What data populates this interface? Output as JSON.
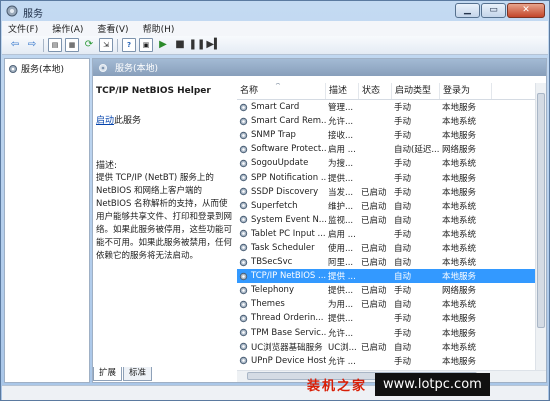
{
  "window": {
    "title": "服务"
  },
  "menu": [
    "文件(F)",
    "操作(A)",
    "查看(V)",
    "帮助(H)"
  ],
  "left_tree": {
    "item": "服务(本地)"
  },
  "right_header": {
    "title": "服务(本地)"
  },
  "description": {
    "service_name": "TCP/IP NetBIOS Helper",
    "start_link": "启动",
    "start_suffix": "此服务",
    "label": "描述:",
    "text": "提供 TCP/IP (NetBT) 服务上的 NetBIOS 和网络上客户端的 NetBIOS 名称解析的支持，从而使用户能够共享文件、打印和登录到网络。如果此服务被停用，这些功能可能不可用。如果此服务被禁用，任何依赖它的服务将无法启动。"
  },
  "table": {
    "headers": [
      "名称",
      "描述",
      "状态",
      "启动类型",
      "登录为"
    ],
    "rows": [
      {
        "name": "Smart Card",
        "desc": "管理...",
        "status": "",
        "startup": "手动",
        "logon": "本地服务"
      },
      {
        "name": "Smart Card Rem...",
        "desc": "允许...",
        "status": "",
        "startup": "手动",
        "logon": "本地系统"
      },
      {
        "name": "SNMP Trap",
        "desc": "接收...",
        "status": "",
        "startup": "手动",
        "logon": "本地服务"
      },
      {
        "name": "Software Protect...",
        "desc": "启用 ...",
        "status": "",
        "startup": "自动(延迟...",
        "logon": "网络服务"
      },
      {
        "name": "SogouUpdate",
        "desc": "为搜...",
        "status": "",
        "startup": "手动",
        "logon": "本地系统"
      },
      {
        "name": "SPP Notification ...",
        "desc": "提供...",
        "status": "",
        "startup": "手动",
        "logon": "本地服务"
      },
      {
        "name": "SSDP Discovery",
        "desc": "当发...",
        "status": "已启动",
        "startup": "手动",
        "logon": "本地服务"
      },
      {
        "name": "Superfetch",
        "desc": "维护...",
        "status": "已启动",
        "startup": "自动",
        "logon": "本地系统"
      },
      {
        "name": "System Event N...",
        "desc": "监视...",
        "status": "已启动",
        "startup": "自动",
        "logon": "本地系统"
      },
      {
        "name": "Tablet PC Input ...",
        "desc": "启用 ...",
        "status": "",
        "startup": "手动",
        "logon": "本地系统"
      },
      {
        "name": "Task Scheduler",
        "desc": "使用...",
        "status": "已启动",
        "startup": "自动",
        "logon": "本地系统"
      },
      {
        "name": "TBSecSvc",
        "desc": "阿里...",
        "status": "已启动",
        "startup": "自动",
        "logon": "本地系统"
      },
      {
        "name": "TCP/IP NetBIOS ...",
        "desc": "提供 ...",
        "status": "",
        "startup": "自动",
        "logon": "本地服务"
      },
      {
        "name": "Telephony",
        "desc": "提供...",
        "status": "已启动",
        "startup": "手动",
        "logon": "网络服务"
      },
      {
        "name": "Themes",
        "desc": "为用...",
        "status": "已启动",
        "startup": "自动",
        "logon": "本地系统"
      },
      {
        "name": "Thread Orderin...",
        "desc": "提供...",
        "status": "",
        "startup": "手动",
        "logon": "本地服务"
      },
      {
        "name": "TPM Base Servic...",
        "desc": "允许...",
        "status": "",
        "startup": "手动",
        "logon": "本地服务"
      },
      {
        "name": "UC浏览器基础服务",
        "desc": "UC浏...",
        "status": "已启动",
        "startup": "自动",
        "logon": "本地系统"
      },
      {
        "name": "UPnP Device Host",
        "desc": "允许 ...",
        "status": "",
        "startup": "手动",
        "logon": "本地服务"
      }
    ],
    "selected_row": 12
  },
  "bottom_tabs": [
    "扩展",
    "标准"
  ],
  "watermark": {
    "brand": "装机之家",
    "url": "www.lotpc.com"
  },
  "colors": {
    "selected_row": "#3399ff",
    "header_gradient": "#889fbb",
    "window_frame": "#b9d1ea",
    "watermark_red": "#d81e06"
  },
  "icons": {
    "toolbar": [
      "back-arrow-icon",
      "forward-arrow-icon",
      "console-tree-icon",
      "properties-icon",
      "refresh-icon",
      "export-icon",
      "help-icon",
      "mmc-icon",
      "play-icon",
      "stop-icon",
      "pause-icon",
      "restart-icon"
    ],
    "service": "gear-icon"
  }
}
